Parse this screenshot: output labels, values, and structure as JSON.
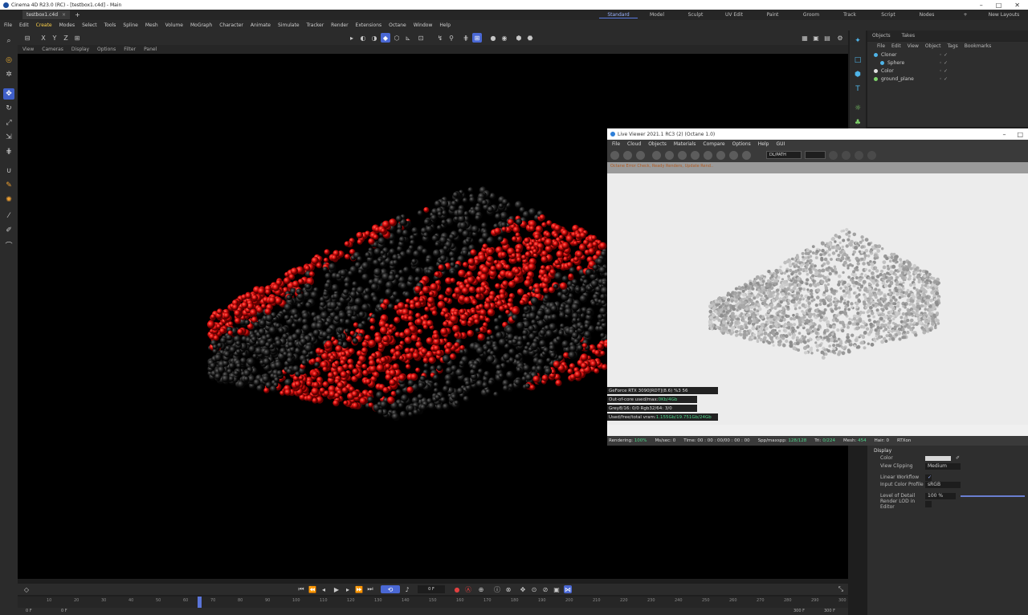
{
  "titlebar": {
    "title": "Cinema 4D R23.0 (RC) - [testbox1.c4d] - Main"
  },
  "doc_tab": {
    "name": "testbox1.c4d"
  },
  "layouts": [
    "Standard",
    "Model",
    "Sculpt",
    "UV Edit",
    "Paint",
    "Groom",
    "Track",
    "Script",
    "Nodes",
    "+",
    "New Layouts"
  ],
  "menubar": [
    "File",
    "Edit",
    "Create",
    "Modes",
    "Select",
    "Tools",
    "Spline",
    "Mesh",
    "Volume",
    "MoGraph",
    "Character",
    "Animate",
    "Simulate",
    "Tracker",
    "Render",
    "Extensions",
    "Octane",
    "Window",
    "Help"
  ],
  "axis": {
    "x": "X",
    "y": "Y",
    "z": "Z"
  },
  "viewport_menu": [
    "View",
    "Cameras",
    "Display",
    "Options",
    "Filter",
    "Panel"
  ],
  "objects": {
    "tabs": [
      "Objects",
      "Takes"
    ],
    "menu": [
      "File",
      "Edit",
      "View",
      "Object",
      "Tags",
      "Bookmarks"
    ],
    "rows": [
      {
        "name": "Cloner",
        "color": "#4fb4e8"
      },
      {
        "name": "Sphere",
        "color": "#4fb4e8"
      },
      {
        "name": "Color",
        "color": "#e0e0e0"
      },
      {
        "name": "ground_plane",
        "color": "#7fd36b"
      }
    ]
  },
  "attributes": {
    "section": "Display",
    "rows": [
      {
        "label": "Color",
        "value": ""
      },
      {
        "label": "View Clipping",
        "value": "Medium"
      },
      {
        "label": "Linear Workflow",
        "value": "✓"
      },
      {
        "label": "Input Color Profile",
        "value": "sRGB"
      },
      {
        "label": "Level of Detail",
        "value": "100 %"
      },
      {
        "label": "Render LOD in Editor",
        "value": ""
      }
    ]
  },
  "timeline": {
    "frame": "0 F",
    "ticks": [
      "10",
      "20",
      "30",
      "40",
      "50",
      "60",
      "70",
      "80",
      "90",
      "100",
      "110",
      "120",
      "130",
      "140",
      "150",
      "160",
      "170",
      "180",
      "190",
      "200",
      "210",
      "220",
      "230",
      "240",
      "250",
      "260",
      "270",
      "280",
      "290",
      "300"
    ],
    "start": "0 F",
    "start2": "0 F",
    "end": "300 F",
    "end2": "300 F"
  },
  "live_viewer": {
    "title": "Live Viewer 2021.1 RC3 (2) (Octane 1.0)",
    "menu": [
      "File",
      "Cloud",
      "Objects",
      "Materials",
      "Compare",
      "Options",
      "Help",
      "GUI"
    ],
    "status_line": "Octane Error Check, Ready Renders, Update  Rend..",
    "mode": "DL/PATH",
    "stats": [
      {
        "text": "GeForce RTX 3090[RDT](8.6)   %3   56"
      },
      {
        "text": "Out-of-core used/max:",
        "value": "0Kb/4Gb"
      },
      {
        "text": "Grey8/16: 0/0       Rgb32/64: 3/0"
      },
      {
        "text": "Used/free/total vram:",
        "value": "1.155Gb/19.751Gb/24Gb"
      }
    ],
    "bottom": {
      "rendering_label": "Rendering:",
      "rendering_value": "100%",
      "mssec": "Ms/sec: 0",
      "time_label": "Time:",
      "time_value": "00 : 00 : 00/00 : 00 : 00",
      "spp_label": "Spp/maxspp:",
      "spp_value": "128/128",
      "tri_label": "Tri:",
      "tri_value": "0/224",
      "mesh_label": "Mesh:",
      "mesh_value": "454",
      "hair": "Hair: 0",
      "rtx": "RTXon"
    }
  },
  "colors": {
    "accent": "#4a68d4",
    "sphere_red": "#e01010",
    "sphere_dark": "#2a2a2a",
    "render_bg": "#ececec"
  }
}
